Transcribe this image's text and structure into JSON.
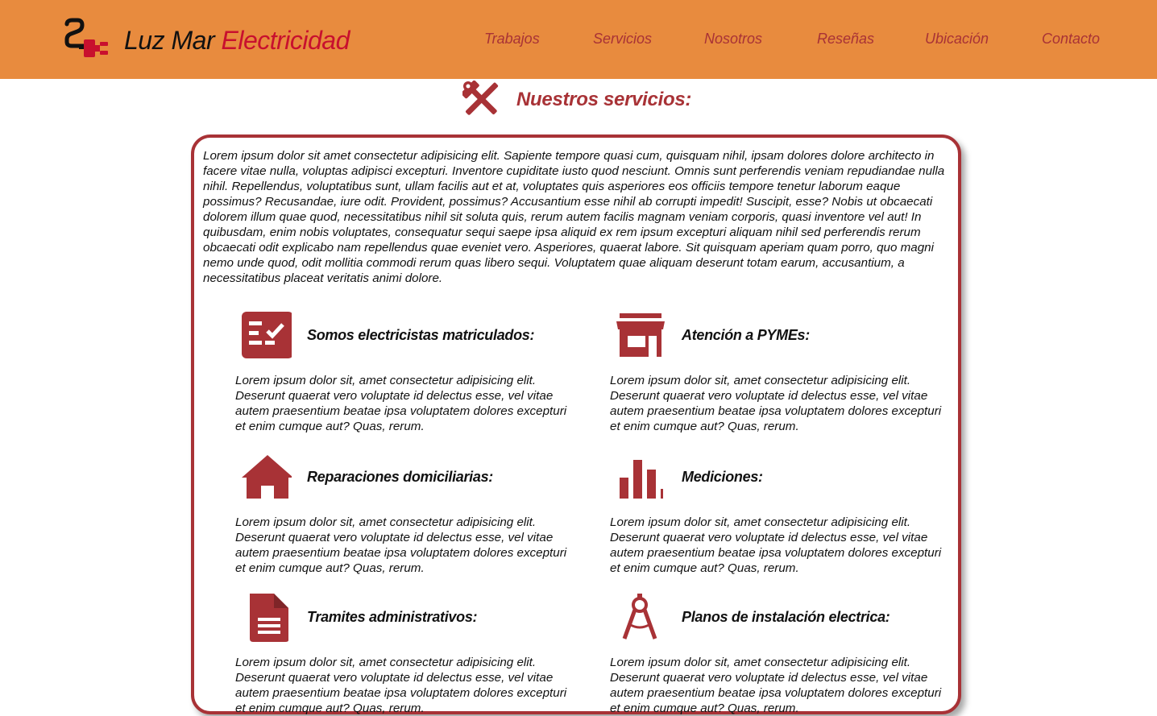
{
  "header": {
    "brand_part1": "Luz Mar",
    "brand_part2": "Electricidad",
    "logo_icon": "electric-plug-icon",
    "nav": [
      "Trabajos",
      "Servicios",
      "Nosotros",
      "Reseñas",
      "Ubicación",
      "Contacto"
    ]
  },
  "section": {
    "title": "Nuestros servicios:",
    "icon": "tools-icon"
  },
  "intro": "Lorem ipsum dolor sit amet consectetur adipisicing elit. Sapiente tempore quasi cum, quisquam nihil, ipsam dolores dolore architecto in facere vitae nulla, voluptas adipisci excepturi. Inventore cupiditate iusto quod nesciunt. Omnis sunt perferendis veniam repudiandae nulla nihil. Repellendus, voluptatibus sunt, ullam facilis aut et at, voluptates quis asperiores eos officiis tempore tenetur laborum eaque possimus? Recusandae, iure odit. Provident, possimus? Accusantium esse nihil ab corrupti impedit! Suscipit, esse? Nobis ut obcaecati dolorem illum quae quod, necessitatibus nihil sit soluta quis, rerum autem facilis magnam veniam corporis, quasi inventore vel aut! In quibusdam, enim nobis voluptates, consequatur sequi saepe ipsa aliquid ex rem ipsum excepturi aliquam nihil sed perferendis rerum obcaecati odit explicabo nam repellendus quae eveniet vero. Asperiores, quaerat labore. Sit quisquam aperiam quam porro, quo magni nemo unde quod, odit mollitia commodi rerum quas libero sequi. Voluptatem quae aliquam deserunt totam earum, accusantium, a necessitatibus placeat veritatis animi dolore.",
  "services": [
    {
      "title": "Somos electricistas matriculados:",
      "icon": "checklist-icon",
      "text": "Lorem ipsum dolor sit, amet consectetur adipisicing elit. Deserunt quaerat vero voluptate id delectus esse, vel vitae autem praesentium beatae ipsa voluptatem dolores excepturi et enim cumque aut? Quas, rerum."
    },
    {
      "title": "Atención a PYMEs:",
      "icon": "store-icon",
      "text": "Lorem ipsum dolor sit, amet consectetur adipisicing elit. Deserunt quaerat vero voluptate id delectus esse, vel vitae autem praesentium beatae ipsa voluptatem dolores excepturi et enim cumque aut? Quas, rerum."
    },
    {
      "title": "Reparaciones domiciliarias:",
      "icon": "home-icon",
      "text": "Lorem ipsum dolor sit, amet consectetur adipisicing elit. Deserunt quaerat vero voluptate id delectus esse, vel vitae autem praesentium beatae ipsa voluptatem dolores excepturi et enim cumque aut? Quas, rerum."
    },
    {
      "title": "Mediciones:",
      "icon": "bar-chart-icon",
      "text": "Lorem ipsum dolor sit, amet consectetur adipisicing elit. Deserunt quaerat vero voluptate id delectus esse, vel vitae autem praesentium beatae ipsa voluptatem dolores excepturi et enim cumque aut? Quas, rerum."
    },
    {
      "title": "Tramites administrativos:",
      "icon": "document-icon",
      "text": "Lorem ipsum dolor sit, amet consectetur adipisicing elit. Deserunt quaerat vero voluptate id delectus esse, vel vitae autem praesentium beatae ipsa voluptatem dolores excepturi et enim cumque aut? Quas, rerum."
    },
    {
      "title": "Planos de instalación electrica:",
      "icon": "compass-icon",
      "text": "Lorem ipsum dolor sit, amet consectetur adipisicing elit. Deserunt quaerat vero voluptate id delectus esse, vel vitae autem praesentium beatae ipsa voluptatem dolores excepturi et enim cumque aut? Quas, rerum."
    }
  ],
  "colors": {
    "header_bg": "#e88b3e",
    "accent": "#a83236",
    "brand_red": "#c8102e"
  }
}
